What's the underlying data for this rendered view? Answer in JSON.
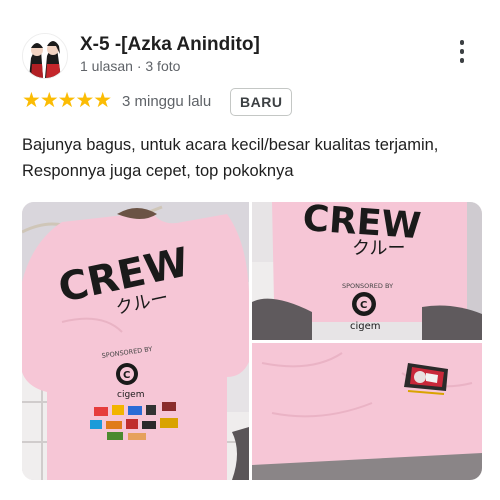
{
  "reviewer": {
    "name": "X-5 -[Azka Anindito]",
    "meta": "1 ulasan · 3 foto",
    "avatar_icon": "anime-avatar-icon"
  },
  "review": {
    "rating": 5,
    "stars": "★★★★★",
    "date": "3 minggu lalu",
    "badge": "BARU",
    "text": "Bajunya bagus, untuk acara kecil/besar kualitas terjamin, Responnya juga cepet, top pokoknya"
  },
  "menu": {
    "icon": "more-vertical-icon"
  },
  "photos": {
    "shirt_text": "CREW",
    "shirt_katakana": "クルー",
    "sponsored_label": "SPONSORED BY",
    "sponsor_logo_letter": "C",
    "sponsor_name": "cigem"
  },
  "colors": {
    "star": "#fbbc04",
    "shirt_pink": "#f6c6d6",
    "text_primary": "#1f1f1f",
    "text_secondary": "#5f6368"
  }
}
